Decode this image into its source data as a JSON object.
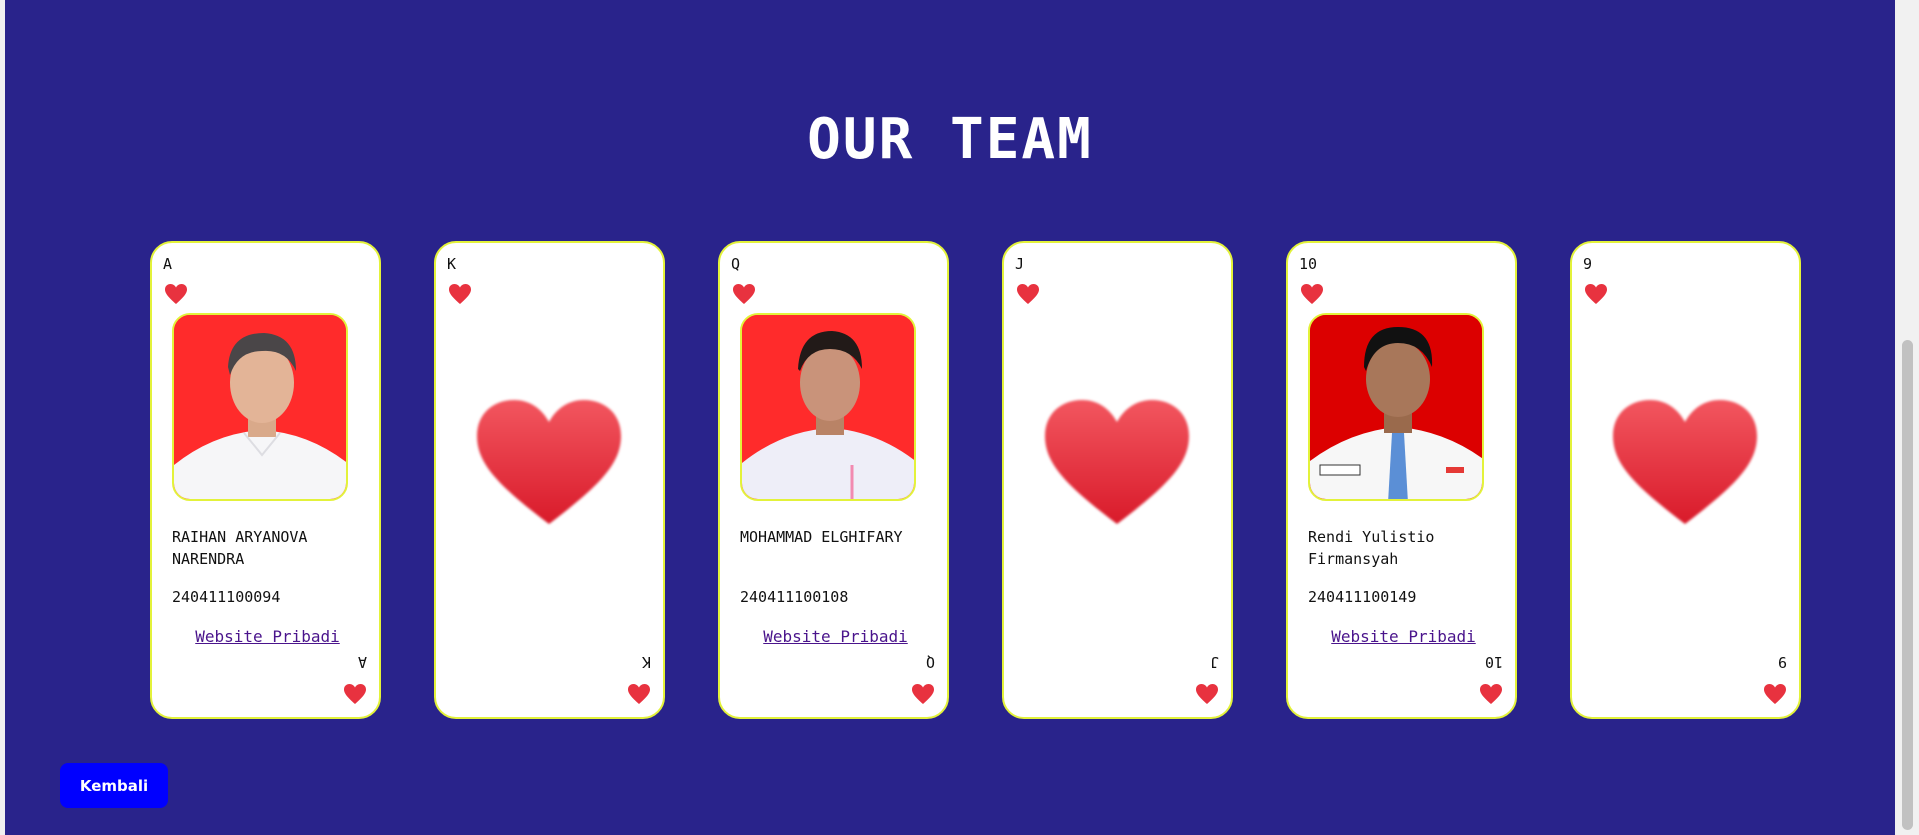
{
  "title": "OUR TEAM",
  "colors": {
    "background": "#29238b",
    "card_border": "#e3f23a",
    "heart": "#e8323f",
    "button": "#0000ff",
    "link": "#4a148c"
  },
  "cards": [
    {
      "rank": "A",
      "suit_icon": "heart-icon",
      "name": "RAIHAN ARYANOVA NARENDRA",
      "nim": "240411100094",
      "link": "Website Pribadi",
      "photo_bg": "#ff2b2b"
    },
    {
      "rank": "K",
      "suit_icon": "heart-icon"
    },
    {
      "rank": "Q",
      "suit_icon": "heart-icon",
      "name": "MOHAMMAD ELGHIFARY",
      "nim": "240411100108",
      "link": "Website Pribadi",
      "photo_bg": "#ff2b2b"
    },
    {
      "rank": "J",
      "suit_icon": "heart-icon"
    },
    {
      "rank": "10",
      "suit_icon": "heart-icon",
      "name": "Rendi Yulistio Firmansyah",
      "nim": "240411100149",
      "link": "Website Pribadi",
      "photo_bg": "#dc0000"
    },
    {
      "rank": "9",
      "suit_icon": "heart-icon"
    }
  ],
  "back_button": "Kembali"
}
